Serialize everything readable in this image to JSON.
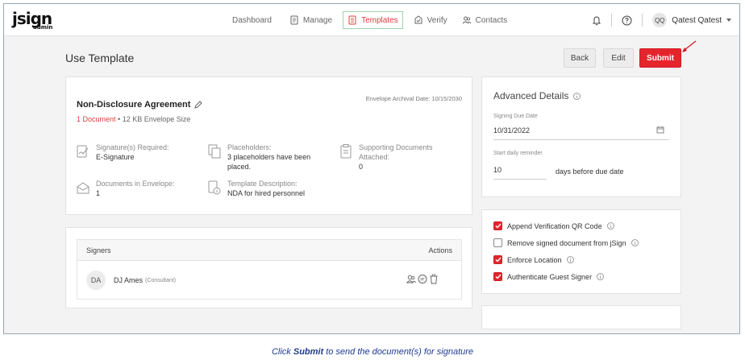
{
  "app": {
    "logo_main": "jsign",
    "logo_sub": "admin"
  },
  "nav": {
    "dashboard": "Dashboard",
    "manage": "Manage",
    "templates": "Templates",
    "verify": "Verify",
    "contacts": "Contacts"
  },
  "user": {
    "initials": "QQ",
    "name": "Qatest Qatest"
  },
  "page": {
    "title": "Use Template"
  },
  "actions": {
    "back": "Back",
    "edit": "Edit",
    "submit": "Submit"
  },
  "document": {
    "title": "Non-Disclosure Agreement",
    "doc_count": "1 Document",
    "envelope_size": "12 KB Envelope Size",
    "archival_date": "Envelope Archival Date: 10/15/2030",
    "signatures_label": "Signature(s) Required:",
    "signatures_value": "E-Signature",
    "placeholders_label": "Placeholders:",
    "placeholders_value_1": "3 placeholders have been",
    "placeholders_value_2": "placed.",
    "supporting_label_1": "Supporting Documents",
    "supporting_label_2": "Attached:",
    "supporting_value": "0",
    "docs_in_envelope_label": "Documents in Envelope:",
    "docs_in_envelope_value": "1",
    "template_desc_label": "Template Description:",
    "template_desc_value": "NDA for hired personnel"
  },
  "signers": {
    "header": "Signers",
    "actions_header": "Actions",
    "rows": [
      {
        "initials": "DA",
        "name": "DJ Ames",
        "role": "(Consultant)"
      }
    ]
  },
  "advanced": {
    "title": "Advanced Details",
    "due_date_label": "Signing Due Date",
    "due_date_value": "10/31/2022",
    "reminder_label": "Start daily reminder",
    "reminder_value": "10",
    "reminder_suffix": "days before due date"
  },
  "options": [
    {
      "label": "Append Verification QR Code",
      "checked": true
    },
    {
      "label": "Remove signed document from jSign",
      "checked": false
    },
    {
      "label": "Enforce Location",
      "checked": true
    },
    {
      "label": "Authenticate Guest Signer",
      "checked": true
    }
  ],
  "caption": {
    "prefix": "Click ",
    "bold": "Submit",
    "suffix": " to send the document(s) for signature"
  },
  "colors": {
    "accent": "#e4252c",
    "nav_active_border": "#9fd3ad",
    "caption": "#1f3a93"
  }
}
